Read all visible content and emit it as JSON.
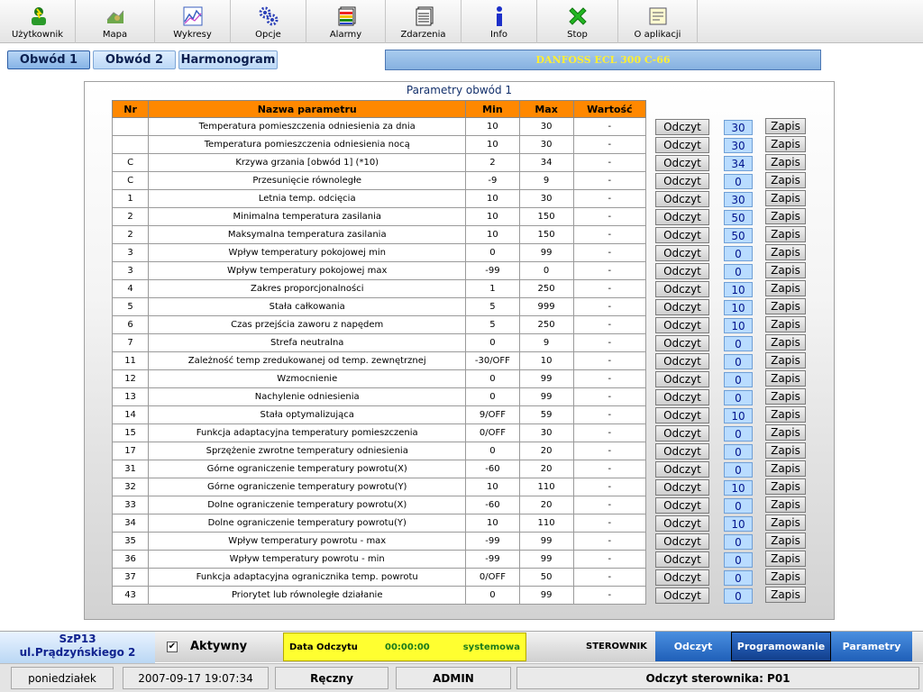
{
  "toolbar": {
    "items": [
      {
        "label": "Użytkownik",
        "icon": "user-icon"
      },
      {
        "label": "Mapa",
        "icon": "map-icon"
      },
      {
        "label": "Wykresy",
        "icon": "chart-icon"
      },
      {
        "label": "Opcje",
        "icon": "gears-icon"
      },
      {
        "label": "Alarmy",
        "icon": "alarms-icon"
      },
      {
        "label": "Zdarzenia",
        "icon": "events-icon"
      },
      {
        "label": "Info",
        "icon": "info-icon"
      },
      {
        "label": "Stop",
        "icon": "stop-icon"
      },
      {
        "label": "O aplikacji",
        "icon": "about-icon"
      }
    ]
  },
  "tabs": [
    "Obwód 1",
    "Obwód 2",
    "Harmonogram"
  ],
  "device_title": "DANFOSS ECL 300 C-66",
  "panel": {
    "title": "Parametry obwód 1",
    "columns": [
      "Nr",
      "Nazwa parametru",
      "Min",
      "Max",
      "Wartość"
    ],
    "read_label": "Odczyt",
    "write_label": "Zapis",
    "rows": [
      {
        "nr": "",
        "name": "Temperatura pomieszczenia odniesienia za dnia",
        "min": "10",
        "max": "30",
        "value": "-",
        "setting": "30"
      },
      {
        "nr": "",
        "name": "Temperatura pomieszczenia odniesienia nocą",
        "min": "10",
        "max": "30",
        "value": "-",
        "setting": "30"
      },
      {
        "nr": "C",
        "name": "Krzywa grzania [obwód 1] (*10)",
        "min": "2",
        "max": "34",
        "value": "-",
        "setting": "34"
      },
      {
        "nr": "C",
        "name": "Przesunięcie równoległe",
        "min": "-9",
        "max": "9",
        "value": "-",
        "setting": "0"
      },
      {
        "nr": "1",
        "name": "Letnia temp. odcięcia",
        "min": "10",
        "max": "30",
        "value": "-",
        "setting": "30"
      },
      {
        "nr": "2",
        "name": "Minimalna temperatura zasilania",
        "min": "10",
        "max": "150",
        "value": "-",
        "setting": "50"
      },
      {
        "nr": "2",
        "name": "Maksymalna temperatura zasilania",
        "min": "10",
        "max": "150",
        "value": "-",
        "setting": "50"
      },
      {
        "nr": "3",
        "name": "Wpływ temperatury pokojowej min",
        "min": "0",
        "max": "99",
        "value": "-",
        "setting": "0"
      },
      {
        "nr": "3",
        "name": "Wpływ temperatury pokojowej max",
        "min": "-99",
        "max": "0",
        "value": "-",
        "setting": "0"
      },
      {
        "nr": "4",
        "name": "Zakres proporcjonalności",
        "min": "1",
        "max": "250",
        "value": "-",
        "setting": "10"
      },
      {
        "nr": "5",
        "name": "Stała całkowania",
        "min": "5",
        "max": "999",
        "value": "-",
        "setting": "10"
      },
      {
        "nr": "6",
        "name": "Czas przejścia zaworu z napędem",
        "min": "5",
        "max": "250",
        "value": "-",
        "setting": "10"
      },
      {
        "nr": "7",
        "name": "Strefa neutralna",
        "min": "0",
        "max": "9",
        "value": "-",
        "setting": "0"
      },
      {
        "nr": "11",
        "name": "Zależność temp zredukowanej od temp. zewnętrznej",
        "min": "-30/OFF",
        "max": "10",
        "value": "-",
        "setting": "0"
      },
      {
        "nr": "12",
        "name": "Wzmocnienie",
        "min": "0",
        "max": "99",
        "value": "-",
        "setting": "0"
      },
      {
        "nr": "13",
        "name": "Nachylenie odniesienia",
        "min": "0",
        "max": "99",
        "value": "-",
        "setting": "0"
      },
      {
        "nr": "14",
        "name": "Stała optymalizująca",
        "min": "9/OFF",
        "max": "59",
        "value": "-",
        "setting": "10"
      },
      {
        "nr": "15",
        "name": "Funkcja adaptacyjna temperatury pomieszczenia",
        "min": "0/OFF",
        "max": "30",
        "value": "-",
        "setting": "0"
      },
      {
        "nr": "17",
        "name": "Sprzężenie zwrotne temperatury odniesienia",
        "min": "0",
        "max": "20",
        "value": "-",
        "setting": "0"
      },
      {
        "nr": "31",
        "name": "Górne ograniczenie temperatury powrotu(X)",
        "min": "-60",
        "max": "20",
        "value": "-",
        "setting": "0"
      },
      {
        "nr": "32",
        "name": "Górne ograniczenie temperatury powrotu(Y)",
        "min": "10",
        "max": "110",
        "value": "-",
        "setting": "10"
      },
      {
        "nr": "33",
        "name": "Dolne ograniczenie temperatury powrotu(X)",
        "min": "-60",
        "max": "20",
        "value": "-",
        "setting": "0"
      },
      {
        "nr": "34",
        "name": "Dolne ograniczenie temperatury powrotu(Y)",
        "min": "10",
        "max": "110",
        "value": "-",
        "setting": "10"
      },
      {
        "nr": "35",
        "name": "Wpływ temperatury powrotu - max",
        "min": "-99",
        "max": "99",
        "value": "-",
        "setting": "0"
      },
      {
        "nr": "36",
        "name": "Wpływ temperatury powrotu - min",
        "min": "-99",
        "max": "99",
        "value": "-",
        "setting": "0"
      },
      {
        "nr": "37",
        "name": "Funkcja adaptacyjna ogranicznika temp. powrotu",
        "min": "0/OFF",
        "max": "50",
        "value": "-",
        "setting": "0"
      },
      {
        "nr": "43",
        "name": "Priorytet lub równoległe działanie",
        "min": "0",
        "max": "99",
        "value": "-",
        "setting": "0"
      }
    ]
  },
  "status": {
    "station_line1": "SzP13",
    "station_line2": "ul.Prądzyńskiego 2",
    "active_label": "Aktywny",
    "active_checked": "✔",
    "read_date_label": "Data Odczytu",
    "read_time": "00:00:00",
    "read_source": "systemowa",
    "controller_label": "STEROWNIK",
    "buttons": [
      "Odczyt",
      "Programowanie",
      "Parametry"
    ]
  },
  "footer": {
    "day": "poniedziałek",
    "datetime": "2007-09-17 19:07:34",
    "mode": "Ręczny",
    "user": "ADMIN",
    "message": "Odczyt sterownika: P01"
  },
  "colors": {
    "header": "#ff8800",
    "accent_blue": "#1f5fb8",
    "status_yellow": "#ffff30"
  }
}
